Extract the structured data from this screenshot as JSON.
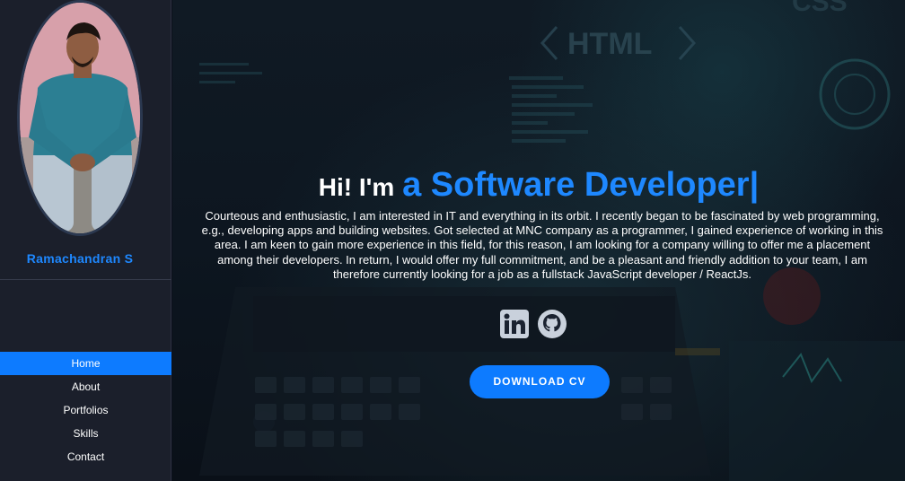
{
  "profile": {
    "name": "Ramachandran S"
  },
  "nav": {
    "items": [
      {
        "label": "Home",
        "active": true
      },
      {
        "label": "About",
        "active": false
      },
      {
        "label": "Portfolios",
        "active": false
      },
      {
        "label": "Skills",
        "active": false
      },
      {
        "label": "Contact",
        "active": false
      }
    ]
  },
  "hero": {
    "greeting": "Hi! I'm",
    "role": "a Software Developer|",
    "bio": "Courteous and enthusiastic, I am interested in IT and everything in its orbit. I recently began to be fascinated by web programming, e.g., developing apps and building websites. Got selected at MNC company as a programmer, I gained experience of working in this area. I am keen to gain more experience in this field, for this reason, I am looking for a company willing to offer me a placement among their developers. In return, I would offer my full commitment, and be a pleasant and friendly addition to your team, I am therefore currently looking for a job as a fullstack JavaScript developer / ReactJs.",
    "background_text": [
      "HTML",
      "CSS"
    ],
    "cta_label": "DOWNLOAD CV"
  },
  "socials": [
    {
      "icon": "linkedin-icon"
    },
    {
      "icon": "github-icon"
    }
  ],
  "colors": {
    "accent": "#0d7bff",
    "sidebar_bg": "#1b1f2b",
    "text": "#ffffff"
  }
}
